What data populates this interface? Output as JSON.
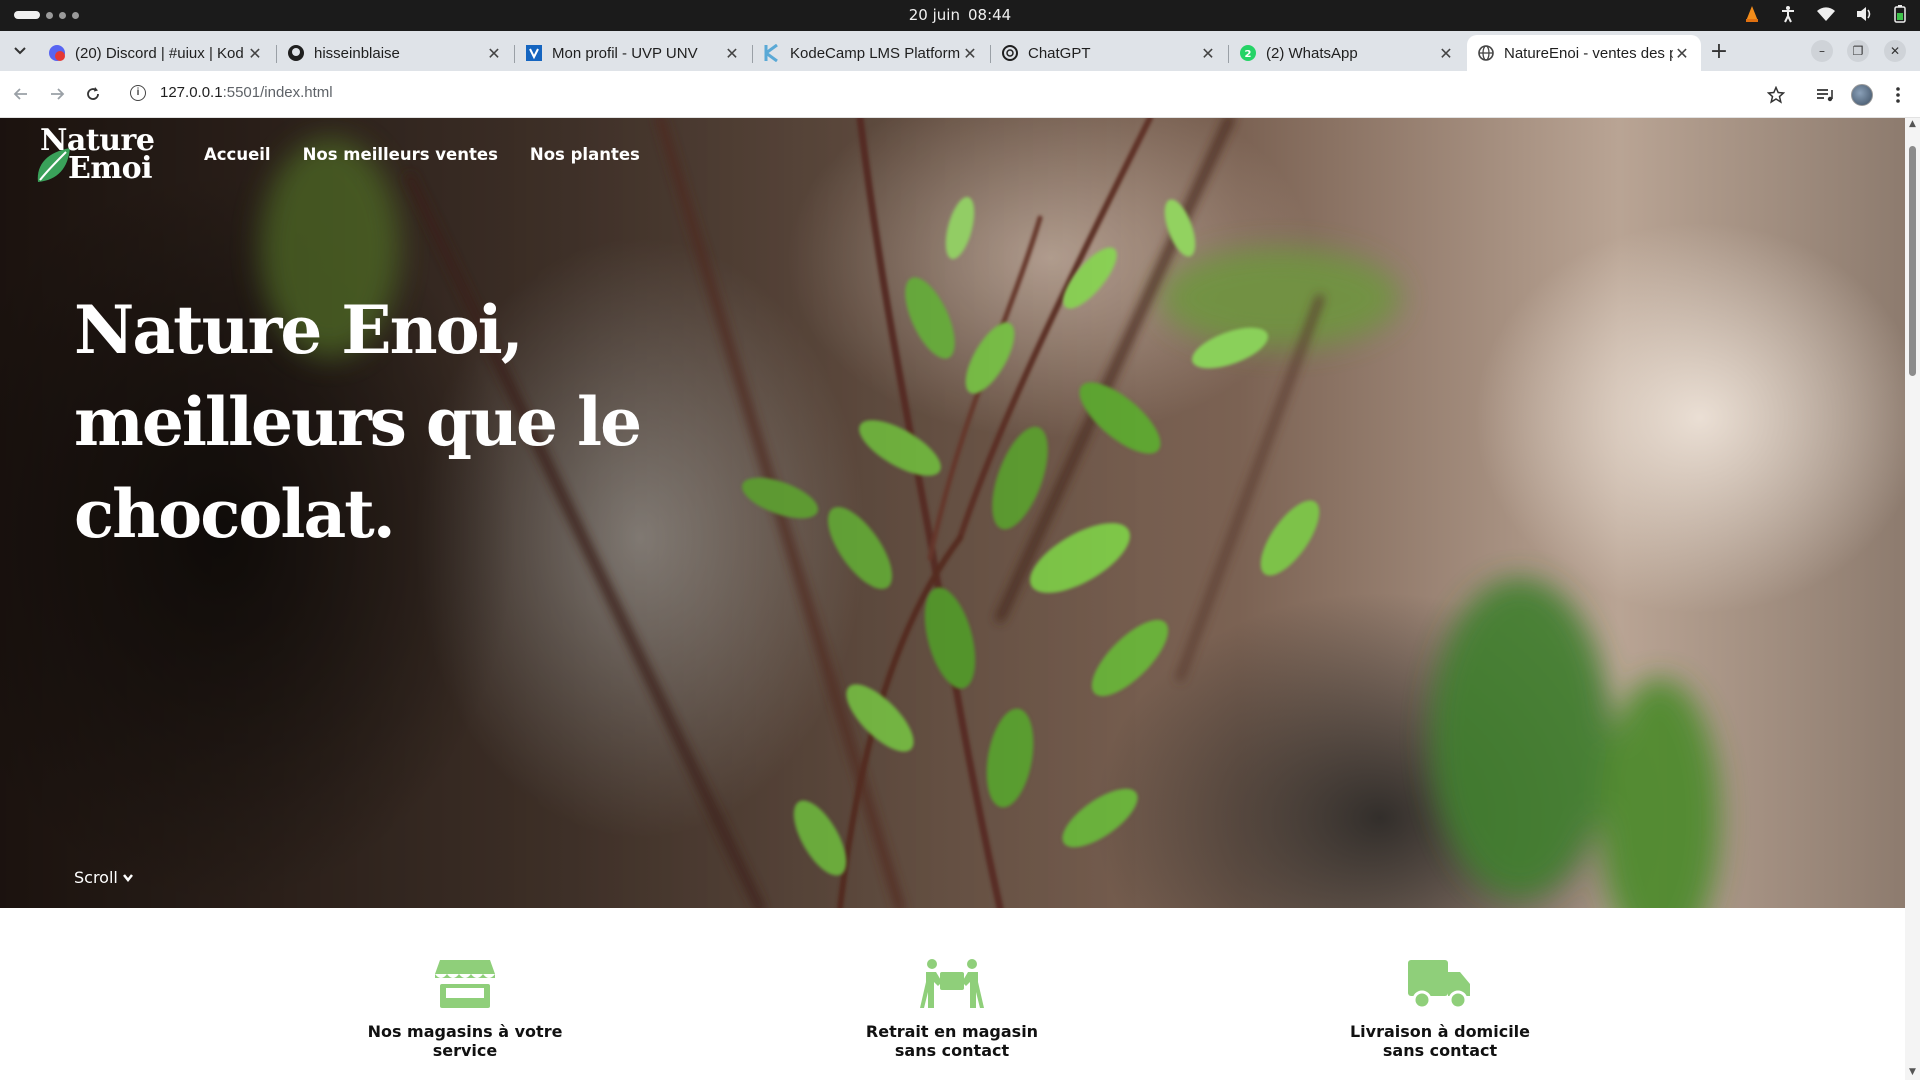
{
  "os": {
    "date": "20 juin",
    "time": "08:44"
  },
  "tabs": [
    {
      "title": "(20) Discord | #uiux | Kod",
      "icon": "discord-icon",
      "badge": "20"
    },
    {
      "title": "hisseinblaise",
      "icon": "github-icon"
    },
    {
      "title": "Mon profil - UVP UNV",
      "icon": "uvp-icon"
    },
    {
      "title": "KodeCamp LMS Platform",
      "icon": "kodecamp-icon"
    },
    {
      "title": "ChatGPT",
      "icon": "chatgpt-icon"
    },
    {
      "title": "(2) WhatsApp",
      "icon": "whatsapp-icon",
      "badge": "2"
    },
    {
      "title": "NatureEnoi - ventes des p",
      "icon": "globe-icon",
      "active": true
    }
  ],
  "address": {
    "host": "127.0.0.1",
    "path": ":5501/index.html"
  },
  "site": {
    "logo": {
      "line1": "Nature",
      "line2": "Emoi"
    },
    "nav": [
      "Accueil",
      "Nos meilleurs ventes",
      "Nos plantes"
    ],
    "hero_title": "Nature Enoi, meilleurs que le chocolat.",
    "scroll_label": "Scroll",
    "features": [
      {
        "label": "Nos magasins à votre service",
        "icon": "store-icon"
      },
      {
        "label": "Retrait en magasin sans contact",
        "icon": "people-carry-box-icon"
      },
      {
        "label": "Livraison à domicile sans contact",
        "icon": "delivery-truck-icon"
      }
    ]
  },
  "colors": {
    "accent_green": "#8fcf7a",
    "logo_leaf_green": "#3aa15a",
    "os_bar": "#1b1b1b",
    "tab_strip": "#dfe3e8"
  }
}
